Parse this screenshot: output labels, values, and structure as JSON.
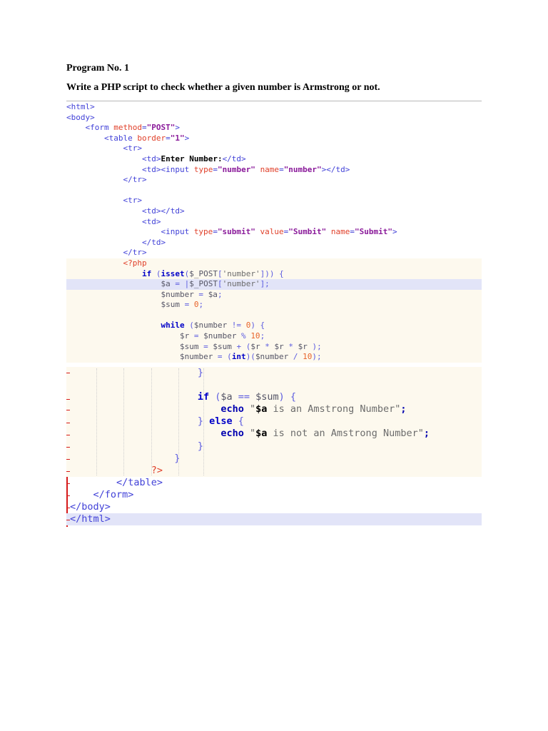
{
  "document": {
    "program_title": "Program No. 1",
    "question": "Write a PHP script to check whether a given number is Armstrong or not."
  },
  "code_top": [
    [
      [
        "t",
        "<html>"
      ]
    ],
    [
      [
        "t",
        "<body>"
      ]
    ],
    [
      [
        "w",
        "    "
      ],
      [
        "t",
        "<form "
      ],
      [
        "a",
        "method"
      ],
      [
        "t",
        "="
      ],
      [
        "s",
        "\"POST\""
      ],
      [
        "t",
        ">"
      ]
    ],
    [
      [
        "w",
        "        "
      ],
      [
        "t",
        "<table "
      ],
      [
        "a",
        "border"
      ],
      [
        "t",
        "="
      ],
      [
        "s",
        "\"1\""
      ],
      [
        "t",
        ">"
      ]
    ],
    [
      [
        "w",
        "            "
      ],
      [
        "t",
        "<tr>"
      ]
    ],
    [
      [
        "w",
        "                "
      ],
      [
        "t",
        "<td>"
      ],
      [
        "b",
        "Enter Number:"
      ],
      [
        "t",
        "</td>"
      ]
    ],
    [
      [
        "w",
        "                "
      ],
      [
        "t",
        "<td><input "
      ],
      [
        "a",
        "type"
      ],
      [
        "t",
        "="
      ],
      [
        "s",
        "\"number\""
      ],
      [
        "t",
        " "
      ],
      [
        "a",
        "name"
      ],
      [
        "t",
        "="
      ],
      [
        "s",
        "\"number\""
      ],
      [
        "t",
        "></td>"
      ]
    ],
    [
      [
        "w",
        "            "
      ],
      [
        "t",
        "</tr>"
      ]
    ],
    [
      [
        "w",
        ""
      ]
    ],
    [
      [
        "w",
        "            "
      ],
      [
        "t",
        "<tr>"
      ]
    ],
    [
      [
        "w",
        "                "
      ],
      [
        "t",
        "<td></td>"
      ]
    ],
    [
      [
        "w",
        "                "
      ],
      [
        "t",
        "<td>"
      ]
    ],
    [
      [
        "w",
        "                    "
      ],
      [
        "t",
        "<input "
      ],
      [
        "a",
        "type"
      ],
      [
        "t",
        "="
      ],
      [
        "s",
        "\"submit\""
      ],
      [
        "t",
        " "
      ],
      [
        "a",
        "value"
      ],
      [
        "t",
        "="
      ],
      [
        "s",
        "\"Sumbit\""
      ],
      [
        "t",
        " "
      ],
      [
        "a",
        "name"
      ],
      [
        "t",
        "="
      ],
      [
        "s",
        "\"Submit\""
      ],
      [
        "t",
        ">"
      ]
    ],
    [
      [
        "w",
        "                "
      ],
      [
        "t",
        "</td>"
      ]
    ],
    [
      [
        "w",
        "            "
      ],
      [
        "t",
        "</tr>"
      ]
    ],
    [
      [
        "w",
        "            "
      ],
      [
        "pt",
        "<?php"
      ]
    ],
    [
      [
        "w",
        "                "
      ],
      [
        "k",
        "if"
      ],
      [
        "p",
        " ("
      ],
      [
        "k",
        "isset"
      ],
      [
        "p",
        "("
      ],
      [
        "v",
        "$_POST"
      ],
      [
        "p",
        "["
      ],
      [
        "str",
        "'number'"
      ],
      [
        "p",
        "])) {"
      ]
    ],
    [
      [
        "w",
        "                    "
      ],
      [
        "v",
        "$a"
      ],
      [
        "p",
        " = |"
      ],
      [
        "v",
        "$_POST"
      ],
      [
        "p",
        "["
      ],
      [
        "str",
        "'number'"
      ],
      [
        "p",
        "];"
      ]
    ],
    [
      [
        "w",
        "                    "
      ],
      [
        "v",
        "$number"
      ],
      [
        "p",
        " = "
      ],
      [
        "v",
        "$a"
      ],
      [
        "p",
        ";"
      ]
    ],
    [
      [
        "w",
        "                    "
      ],
      [
        "v",
        "$sum"
      ],
      [
        "p",
        " = "
      ],
      [
        "n",
        "0"
      ],
      [
        "p",
        ";"
      ]
    ],
    [
      [
        "w",
        ""
      ]
    ],
    [
      [
        "w",
        "                    "
      ],
      [
        "k",
        "while"
      ],
      [
        "p",
        " ("
      ],
      [
        "v",
        "$number"
      ],
      [
        "p",
        " != "
      ],
      [
        "n",
        "0"
      ],
      [
        "p",
        ") {"
      ]
    ],
    [
      [
        "w",
        "                        "
      ],
      [
        "v",
        "$r"
      ],
      [
        "p",
        " = "
      ],
      [
        "v",
        "$number"
      ],
      [
        "p",
        " % "
      ],
      [
        "n",
        "10"
      ],
      [
        "p",
        ";"
      ]
    ],
    [
      [
        "w",
        "                        "
      ],
      [
        "v",
        "$sum"
      ],
      [
        "p",
        " = "
      ],
      [
        "v",
        "$sum"
      ],
      [
        "p",
        " + ("
      ],
      [
        "v",
        "$r"
      ],
      [
        "p",
        " * "
      ],
      [
        "v",
        "$r"
      ],
      [
        "p",
        " * "
      ],
      [
        "v",
        "$r"
      ],
      [
        "p",
        " );"
      ]
    ],
    [
      [
        "w",
        "                        "
      ],
      [
        "v",
        "$number"
      ],
      [
        "p",
        " = ("
      ],
      [
        "k",
        "int"
      ],
      [
        "p",
        ")("
      ],
      [
        "v",
        "$number"
      ],
      [
        "p",
        " / "
      ],
      [
        "n",
        "10"
      ],
      [
        "p",
        ");"
      ]
    ]
  ],
  "code_bottom": [
    [
      [
        "w",
        "                      "
      ],
      [
        "p",
        "}"
      ]
    ],
    [
      [
        "w",
        ""
      ]
    ],
    [
      [
        "w",
        "                      "
      ],
      [
        "k",
        "if"
      ],
      [
        "p",
        " ("
      ],
      [
        "v",
        "$a"
      ],
      [
        "p",
        " == "
      ],
      [
        "v",
        "$sum"
      ],
      [
        "p",
        ") {"
      ]
    ],
    [
      [
        "w",
        "                          "
      ],
      [
        "e",
        "echo"
      ],
      [
        "p",
        " "
      ],
      [
        "str",
        "\""
      ],
      [
        "b",
        "$a"
      ],
      [
        "str",
        " is an Amstrong Number\""
      ],
      [
        "e",
        ";"
      ]
    ],
    [
      [
        "w",
        "                      "
      ],
      [
        "p",
        "} "
      ],
      [
        "k",
        "else"
      ],
      [
        "p",
        " {"
      ]
    ],
    [
      [
        "w",
        "                          "
      ],
      [
        "e",
        "echo"
      ],
      [
        "p",
        " "
      ],
      [
        "str",
        "\""
      ],
      [
        "b",
        "$a"
      ],
      [
        "str",
        " is not an Amstrong Number\""
      ],
      [
        "e",
        ";"
      ]
    ],
    [
      [
        "w",
        "                      "
      ],
      [
        "p",
        "}"
      ]
    ],
    [
      [
        "w",
        "                  "
      ],
      [
        "p",
        "}"
      ]
    ],
    [
      [
        "w",
        "              "
      ],
      [
        "pt",
        "?>"
      ]
    ],
    [
      [
        "w",
        "        "
      ],
      [
        "t",
        "</table>"
      ]
    ],
    [
      [
        "w",
        "    "
      ],
      [
        "t",
        "</form>"
      ]
    ],
    [
      [
        "t",
        "</body>"
      ]
    ],
    [
      [
        "t",
        "</html>"
      ]
    ]
  ]
}
